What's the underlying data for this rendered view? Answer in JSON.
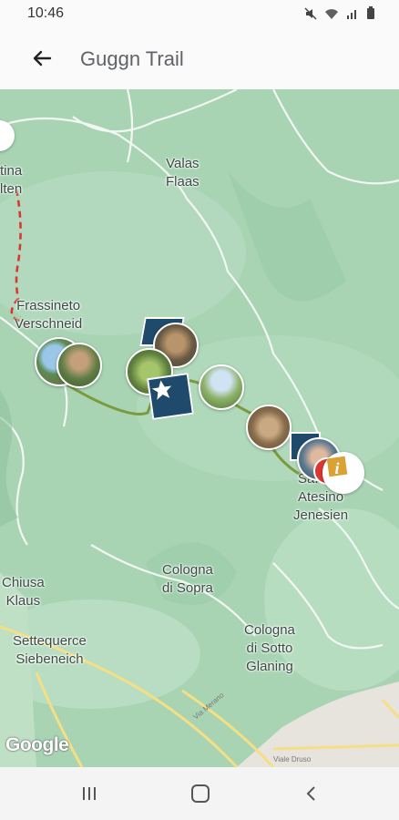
{
  "status_bar": {
    "time": "10:46"
  },
  "app_bar": {
    "title": "Guggn Trail"
  },
  "map": {
    "attribution": "Google",
    "places": [
      {
        "name": "tina\nlten"
      },
      {
        "name": "Valas\nFlaas"
      },
      {
        "name": "Frassineto\nVerschneid"
      },
      {
        "name": "San Genesio\nAtesino\nJenesien",
        "display": "Sa...sio\nAtesino\nJenesien"
      },
      {
        "name": "Cologna\ndi Sopra"
      },
      {
        "name": "Chiusa\nKlaus"
      },
      {
        "name": "Settequerce\nSiebeneich"
      },
      {
        "name": "Cologna\ndi Sotto\nGlaning"
      }
    ],
    "roads": [
      "Via Merano",
      "Viale Druso"
    ]
  },
  "colors": {
    "map_bg": "#a9d5b5",
    "trail": "#7b9a3e",
    "red_route": "#d9382f",
    "marker_dark": "#1f4a6b",
    "info": "#d9a233"
  }
}
